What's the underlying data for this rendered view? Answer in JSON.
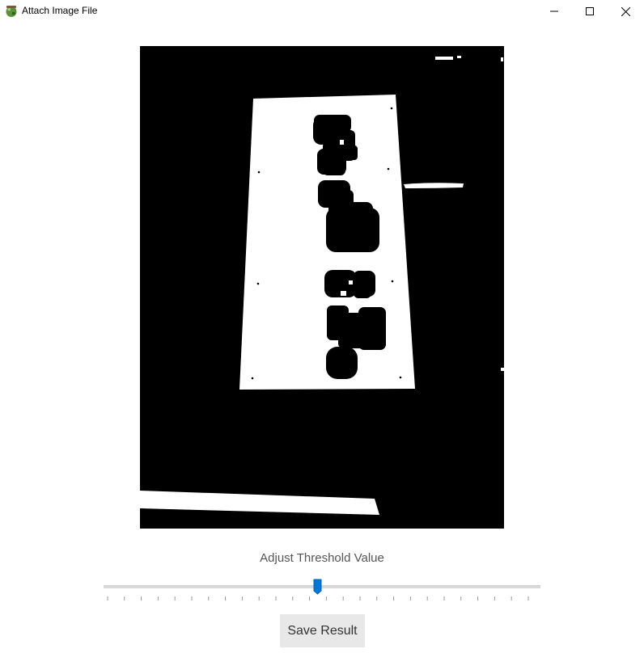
{
  "window": {
    "title": "Attach Image File",
    "app_icon": "app-globe-icon",
    "controls": [
      "minimize-icon",
      "maximize-icon",
      "close-icon"
    ]
  },
  "threshold": {
    "label": "Adjust Threshold Value",
    "value_fraction": 0.49,
    "tick_count": 26
  },
  "actions": {
    "save_label": "Save Result"
  },
  "colors": {
    "slider_thumb": "#0078d7",
    "slider_track": "#d9d9d9",
    "button_bg": "#e8e8e8",
    "image_bg": "#000000",
    "image_fg": "#ffffff"
  }
}
